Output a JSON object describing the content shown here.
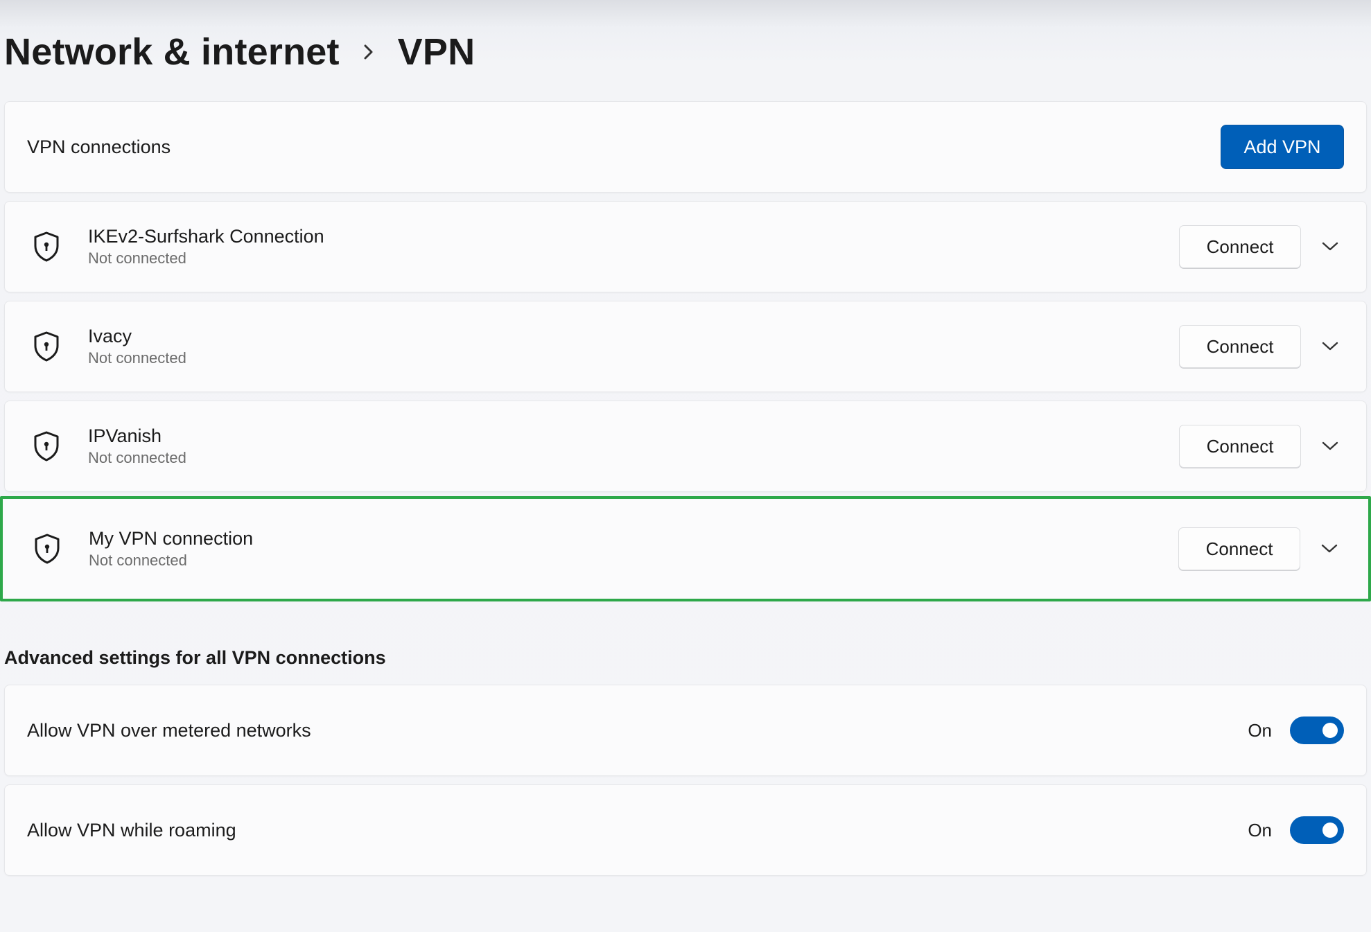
{
  "breadcrumb": {
    "parent": "Network & internet",
    "separator": "›",
    "current": "VPN"
  },
  "connections_header": {
    "label": "VPN connections",
    "add_button": "Add VPN"
  },
  "vpn_connections": [
    {
      "name": "IKEv2-Surfshark Connection",
      "status": "Not connected",
      "action": "Connect",
      "highlighted": false
    },
    {
      "name": "Ivacy",
      "status": "Not connected",
      "action": "Connect",
      "highlighted": false
    },
    {
      "name": "IPVanish",
      "status": "Not connected",
      "action": "Connect",
      "highlighted": false
    },
    {
      "name": "My VPN connection",
      "status": "Not connected",
      "action": "Connect",
      "highlighted": true
    }
  ],
  "advanced": {
    "title": "Advanced settings for all VPN connections",
    "settings": [
      {
        "label": "Allow VPN over metered networks",
        "state": "On",
        "on": true
      },
      {
        "label": "Allow VPN while roaming",
        "state": "On",
        "on": true
      }
    ]
  },
  "colors": {
    "accent": "#005fb8",
    "highlight_border": "#2ea84a"
  },
  "icons": {
    "vpn_item": "shield-icon",
    "expand": "chevron-down-icon",
    "breadcrumb_separator": "chevron-right-icon"
  }
}
